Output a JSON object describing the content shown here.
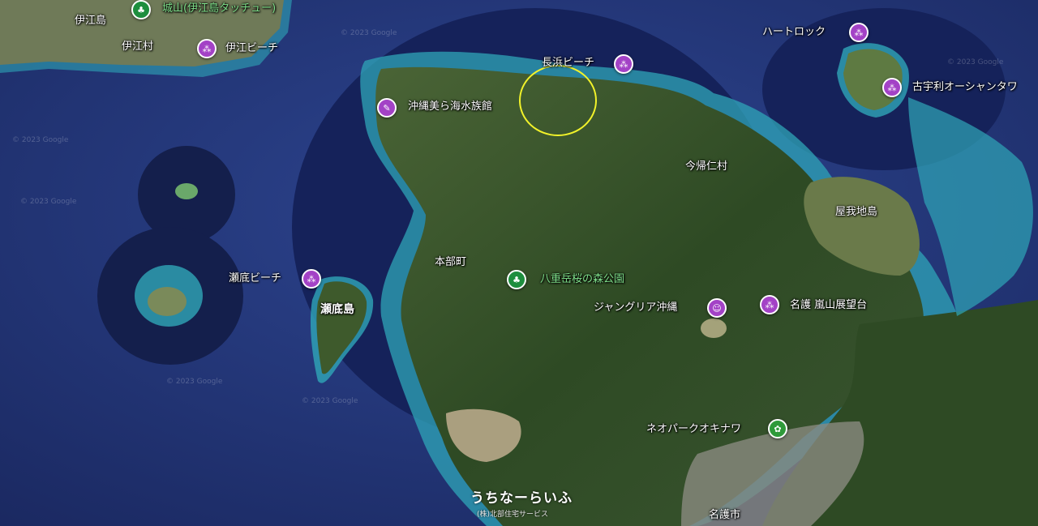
{
  "places": {
    "iejima": "伊江島",
    "iemura": "伊江村",
    "ie_beach": "伊江ビーチ",
    "shiroyama": "城山(伊江島タッチュー)",
    "nagahama_beach": "長浜ビーチ",
    "heart_rock": "ハートロック",
    "kouri_ocean_tower": "古宇利オーシャンタワ",
    "churaumi": "沖縄美ら海水族館",
    "nakijin": "今帰仁村",
    "yagaji": "屋我地島",
    "motobu": "本部町",
    "yaedake": "八重岳桜の森公園",
    "sesoko_beach": "瀬底ビーチ",
    "sesoko_island": "瀬底島",
    "jungleria": "ジャングリア沖縄",
    "arashiyama": "名護 嵐山展望台",
    "neopark": "ネオパークオキナワ",
    "nago": "名護市"
  },
  "watermarks": [
    "© 2023 Google",
    "© 2023 Google",
    "© 2023 Google",
    "© 2023 Google",
    "© 2023 Google",
    "© 2023 Google"
  ],
  "brand": {
    "name": "うちなーらいふ",
    "sub": "(株)北部住宅サービス"
  },
  "colors": {
    "deep_sea": "#1f2f6a",
    "sea": "#2a3f86",
    "reef": "#2fa6b8",
    "land": "#3c5a2a",
    "forest": "#2c4a22",
    "poi_purple": "#a342c6",
    "poi_green": "#1e8e3e",
    "highlight": "#f1f22a"
  }
}
